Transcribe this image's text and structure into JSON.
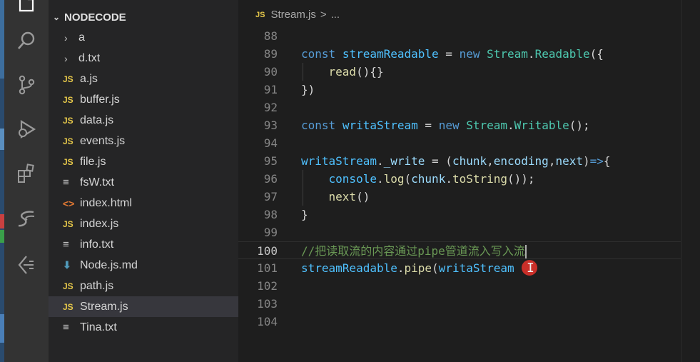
{
  "explorer": {
    "root_label": "NODECODE",
    "items": [
      {
        "name": "a",
        "type": "folder"
      },
      {
        "name": "d.txt",
        "type": "folder"
      },
      {
        "name": "a.js",
        "type": "js"
      },
      {
        "name": "buffer.js",
        "type": "js"
      },
      {
        "name": "data.js",
        "type": "js"
      },
      {
        "name": "events.js",
        "type": "js"
      },
      {
        "name": "file.js",
        "type": "js"
      },
      {
        "name": "fsW.txt",
        "type": "txt"
      },
      {
        "name": "index.html",
        "type": "html"
      },
      {
        "name": "index.js",
        "type": "js"
      },
      {
        "name": "info.txt",
        "type": "txt"
      },
      {
        "name": "Node.js.md",
        "type": "md"
      },
      {
        "name": "path.js",
        "type": "js"
      },
      {
        "name": "Stream.js",
        "type": "js",
        "active": true
      },
      {
        "name": "Tina.txt",
        "type": "txt"
      }
    ]
  },
  "icons": {
    "js_badge": "JS",
    "folder_chevron": "›",
    "root_chevron": "⌄",
    "txt_glyph": "≡",
    "html_glyph": "<>",
    "md_glyph": "⬇"
  },
  "editor": {
    "breadcrumb": {
      "badge": "JS",
      "file": "Stream.js",
      "sep": ">",
      "more": "..."
    },
    "line_numbers": [
      "88",
      "89",
      "90",
      "91",
      "92",
      "93",
      "94",
      "95",
      "96",
      "97",
      "98",
      "99",
      "100",
      "101",
      "102",
      "103",
      "104"
    ],
    "current_line": "100",
    "code": {
      "l89": {
        "t1": "const",
        "t2": "streamReadable",
        "t3": " = ",
        "t4": "new",
        "t5": "Stream",
        "t6": ".",
        "t7": "Readable",
        "t8": "({"
      },
      "l90": {
        "t1": "read",
        "t2": "(){}"
      },
      "l91": {
        "t1": "})"
      },
      "l93": {
        "t1": "const",
        "t2": "writaStream",
        "t3": " = ",
        "t4": "new",
        "t5": "Stream",
        "t6": ".",
        "t7": "Writable",
        "t8": "();"
      },
      "l95": {
        "t1": "writaStream",
        "t2": ".",
        "t3": "_write",
        "t4": " = (",
        "t5": "chunk",
        "t6": ",",
        "t7": "encoding",
        "t8": ",",
        "t9": "next",
        "t10": ")",
        "t11": "=>",
        "t12": "{"
      },
      "l96": {
        "t1": "console",
        "t2": ".",
        "t3": "log",
        "t4": "(",
        "t5": "chunk",
        "t6": ".",
        "t7": "toString",
        "t8": "());"
      },
      "l97": {
        "t1": "next",
        "t2": "()"
      },
      "l98": {
        "t1": "}"
      },
      "l100": {
        "t1": "//把读取流的内容通过pipe管道流入写入流"
      },
      "l101": {
        "t1": "streamReadable",
        "t2": ".",
        "t3": "pipe",
        "t4": "(",
        "t5": "writaStream"
      }
    }
  },
  "colors": {
    "keyword": "#569cd6",
    "variable": "#4fc1ff",
    "class": "#4ec9b0",
    "function": "#dcdcaa",
    "comment": "#6a9955",
    "js_badge": "#e6c84a",
    "html_icon": "#e37933",
    "md_icon": "#519aba",
    "click_marker": "#d3302a"
  }
}
